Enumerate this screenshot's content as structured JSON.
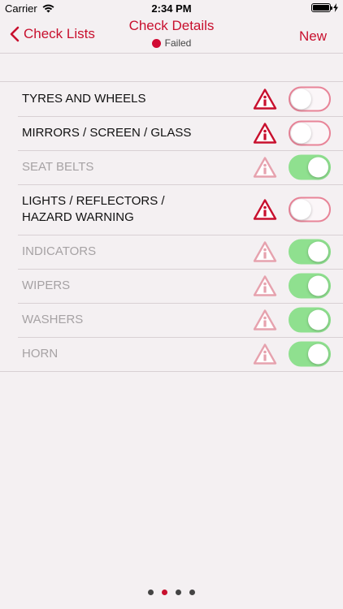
{
  "status_bar": {
    "carrier": "Carrier",
    "time": "2:34 PM"
  },
  "nav": {
    "back_label": "Check Lists",
    "title": "Check Details",
    "status_label": "Failed",
    "new_label": "New"
  },
  "colors": {
    "accent": "#c8102e",
    "failed_dot": "#d10a33",
    "toggle_on": "#8fe08f",
    "toggle_off_border": "#e88498"
  },
  "items": [
    {
      "label": "TYRES AND WHEELS",
      "passed": false
    },
    {
      "label": "MIRRORS / SCREEN / GLASS",
      "passed": false
    },
    {
      "label": "SEAT BELTS",
      "passed": true
    },
    {
      "label": "LIGHTS / REFLECTORS /\nHAZARD WARNING",
      "passed": false
    },
    {
      "label": "INDICATORS",
      "passed": true
    },
    {
      "label": "WIPERS",
      "passed": true
    },
    {
      "label": "WASHERS",
      "passed": true
    },
    {
      "label": "HORN",
      "passed": true
    }
  ],
  "pager": {
    "count": 4,
    "active_index": 1
  },
  "icons": {
    "warning": "warning-info-icon",
    "back": "chevron-left-icon"
  }
}
